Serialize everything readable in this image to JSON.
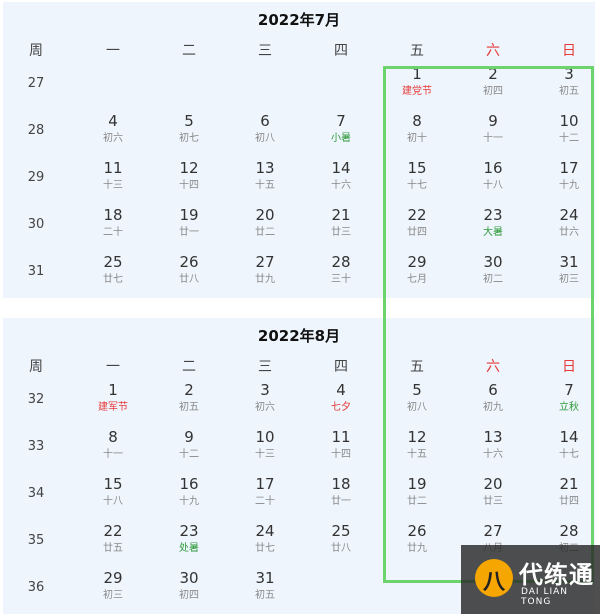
{
  "weekday_headers": [
    "周",
    "一",
    "二",
    "三",
    "四",
    "五",
    "六",
    "日"
  ],
  "weekday_header_colors": [
    "normal",
    "normal",
    "normal",
    "normal",
    "normal",
    "normal",
    "red",
    "red"
  ],
  "months": [
    {
      "title": "2022年7月",
      "weeks": [
        {
          "week": "27",
          "days": [
            null,
            null,
            null,
            null,
            {
              "d": "1",
              "l": "建党节",
              "c": "red"
            },
            {
              "d": "2",
              "l": "初四"
            },
            {
              "d": "3",
              "l": "初五"
            }
          ]
        },
        {
          "week": "28",
          "days": [
            {
              "d": "4",
              "l": "初六"
            },
            {
              "d": "5",
              "l": "初七"
            },
            {
              "d": "6",
              "l": "初八"
            },
            {
              "d": "7",
              "l": "小暑",
              "c": "green"
            },
            {
              "d": "8",
              "l": "初十"
            },
            {
              "d": "9",
              "l": "十一"
            },
            {
              "d": "10",
              "l": "十二"
            }
          ]
        },
        {
          "week": "29",
          "days": [
            {
              "d": "11",
              "l": "十三"
            },
            {
              "d": "12",
              "l": "十四"
            },
            {
              "d": "13",
              "l": "十五"
            },
            {
              "d": "14",
              "l": "十六"
            },
            {
              "d": "15",
              "l": "十七"
            },
            {
              "d": "16",
              "l": "十八"
            },
            {
              "d": "17",
              "l": "十九"
            }
          ]
        },
        {
          "week": "30",
          "days": [
            {
              "d": "18",
              "l": "二十"
            },
            {
              "d": "19",
              "l": "廿一"
            },
            {
              "d": "20",
              "l": "廿二"
            },
            {
              "d": "21",
              "l": "廿三"
            },
            {
              "d": "22",
              "l": "廿四"
            },
            {
              "d": "23",
              "l": "大暑",
              "c": "green"
            },
            {
              "d": "24",
              "l": "廿六"
            }
          ]
        },
        {
          "week": "31",
          "days": [
            {
              "d": "25",
              "l": "廿七"
            },
            {
              "d": "26",
              "l": "廿八"
            },
            {
              "d": "27",
              "l": "廿九"
            },
            {
              "d": "28",
              "l": "三十"
            },
            {
              "d": "29",
              "l": "七月"
            },
            {
              "d": "30",
              "l": "初二"
            },
            {
              "d": "31",
              "l": "初三"
            }
          ]
        }
      ]
    },
    {
      "title": "2022年8月",
      "weeks": [
        {
          "week": "32",
          "days": [
            {
              "d": "1",
              "l": "建军节",
              "c": "red"
            },
            {
              "d": "2",
              "l": "初五"
            },
            {
              "d": "3",
              "l": "初六"
            },
            {
              "d": "4",
              "l": "七夕",
              "c": "red"
            },
            {
              "d": "5",
              "l": "初八"
            },
            {
              "d": "6",
              "l": "初九"
            },
            {
              "d": "7",
              "l": "立秋",
              "c": "green"
            }
          ]
        },
        {
          "week": "33",
          "days": [
            {
              "d": "8",
              "l": "十一"
            },
            {
              "d": "9",
              "l": "十二"
            },
            {
              "d": "10",
              "l": "十三"
            },
            {
              "d": "11",
              "l": "十四"
            },
            {
              "d": "12",
              "l": "十五"
            },
            {
              "d": "13",
              "l": "十六"
            },
            {
              "d": "14",
              "l": "十七"
            }
          ]
        },
        {
          "week": "34",
          "days": [
            {
              "d": "15",
              "l": "十八"
            },
            {
              "d": "16",
              "l": "十九"
            },
            {
              "d": "17",
              "l": "二十"
            },
            {
              "d": "18",
              "l": "廿一"
            },
            {
              "d": "19",
              "l": "廿二"
            },
            {
              "d": "20",
              "l": "廿三"
            },
            {
              "d": "21",
              "l": "廿四"
            }
          ]
        },
        {
          "week": "35",
          "days": [
            {
              "d": "22",
              "l": "廿五"
            },
            {
              "d": "23",
              "l": "处暑",
              "c": "green"
            },
            {
              "d": "24",
              "l": "廿七"
            },
            {
              "d": "25",
              "l": "廿八"
            },
            {
              "d": "26",
              "l": "廿九"
            },
            {
              "d": "27",
              "l": "八月"
            },
            {
              "d": "28",
              "l": "初二"
            }
          ]
        },
        {
          "week": "36",
          "days": [
            {
              "d": "29",
              "l": "初三"
            },
            {
              "d": "30",
              "l": "初四"
            },
            {
              "d": "31",
              "l": "初五"
            },
            null,
            null,
            null,
            null
          ]
        }
      ]
    }
  ],
  "highlight": {
    "columns": [
      "五",
      "六",
      "日"
    ],
    "color": "#6dd46d"
  },
  "colors": {
    "red": "#e53a3a",
    "green": "#2e9a3a",
    "panel_bg": "#eef5fc"
  },
  "watermark": {
    "icon": "daiiantong-logo-icon",
    "text_cn": "代练通",
    "text_en": "DAI LIAN TONG"
  }
}
